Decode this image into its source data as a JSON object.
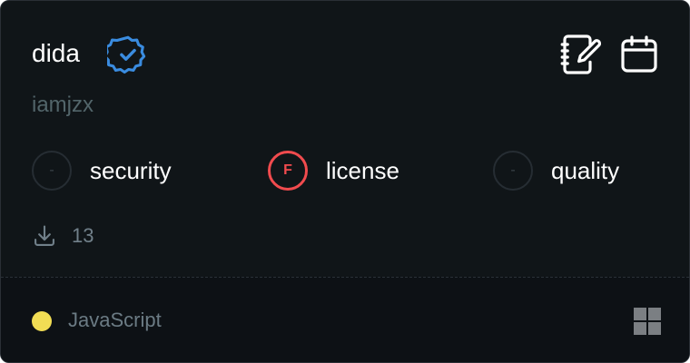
{
  "package": {
    "name": "dida",
    "author": "iamjzx"
  },
  "metrics": [
    {
      "label": "security",
      "grade": "-",
      "state": "none"
    },
    {
      "label": "license",
      "grade": "F",
      "state": "fail"
    },
    {
      "label": "quality",
      "grade": "-",
      "state": "none"
    }
  ],
  "downloads": {
    "count": "13"
  },
  "footer": {
    "language": "JavaScript",
    "language_color": "#f1dd54"
  },
  "icons": {
    "verified": "verified-badge-icon",
    "edit": "edit-notebook-icon",
    "calendar": "calendar-icon",
    "download": "download-icon",
    "platform": "windows-icon"
  },
  "colors": {
    "verified": "#3a8ce0",
    "fail": "#f14b4e",
    "card_bg": "#101518",
    "footer_bg": "#0d1115"
  }
}
